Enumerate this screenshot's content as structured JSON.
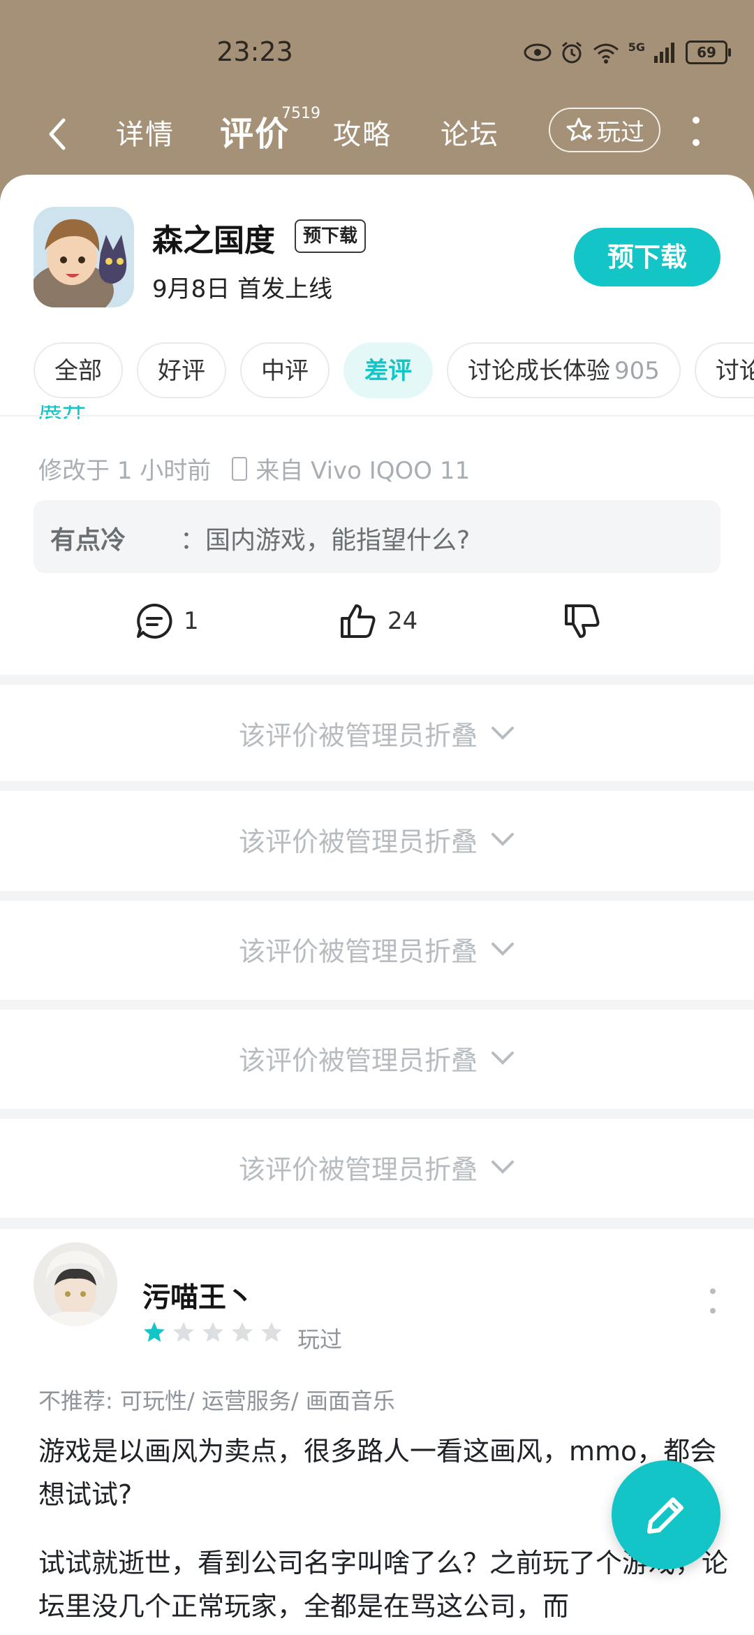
{
  "status": {
    "time": "23:23",
    "battery": "69",
    "network": "5G"
  },
  "nav": {
    "tabs": [
      {
        "label": "详情"
      },
      {
        "label": "评价",
        "count": "7519"
      },
      {
        "label": "攻略"
      },
      {
        "label": "论坛"
      }
    ],
    "played_label": "玩过"
  },
  "game": {
    "title": "森之国度",
    "badge": "预下载",
    "release": "9月8日 首发上线",
    "action_label": "预下载"
  },
  "filters": [
    {
      "label": "全部"
    },
    {
      "label": "好评"
    },
    {
      "label": "中评"
    },
    {
      "label": "差评",
      "active": true
    },
    {
      "label": "讨论成长体验",
      "count": "905"
    },
    {
      "label": "讨论"
    }
  ],
  "review1": {
    "expand_label": "展开",
    "modified": "修改于 1 小时前",
    "device": "来自 Vivo IQOO 11",
    "reply_author": "有点冷",
    "reply_text": "：国内游戏，能指望什么?",
    "comments": "1",
    "likes": "24"
  },
  "folded": [
    {
      "text": "该评价被管理员折叠"
    },
    {
      "text": "该评价被管理员折叠"
    },
    {
      "text": "该评价被管理员折叠"
    },
    {
      "text": "该评价被管理员折叠"
    },
    {
      "text": "该评价被管理员折叠"
    }
  ],
  "review2": {
    "user": "污喵王丶",
    "rating": 1,
    "max_rating": 5,
    "played_tag": "玩过",
    "not_recommend": "不推荐: 可玩性/ 运营服务/ 画面音乐",
    "paragraphs": [
      "游戏是以画风为卖点，很多路人一看这画风，mmo，都会想试试?",
      "试试就逝世，看到公司名字叫啥了么？之前玩了个游戏，论坛里没几个正常玩家，全都是在骂这公司，而"
    ]
  },
  "colors": {
    "accent": "#14c5c7",
    "header_bg": "#a59178"
  }
}
